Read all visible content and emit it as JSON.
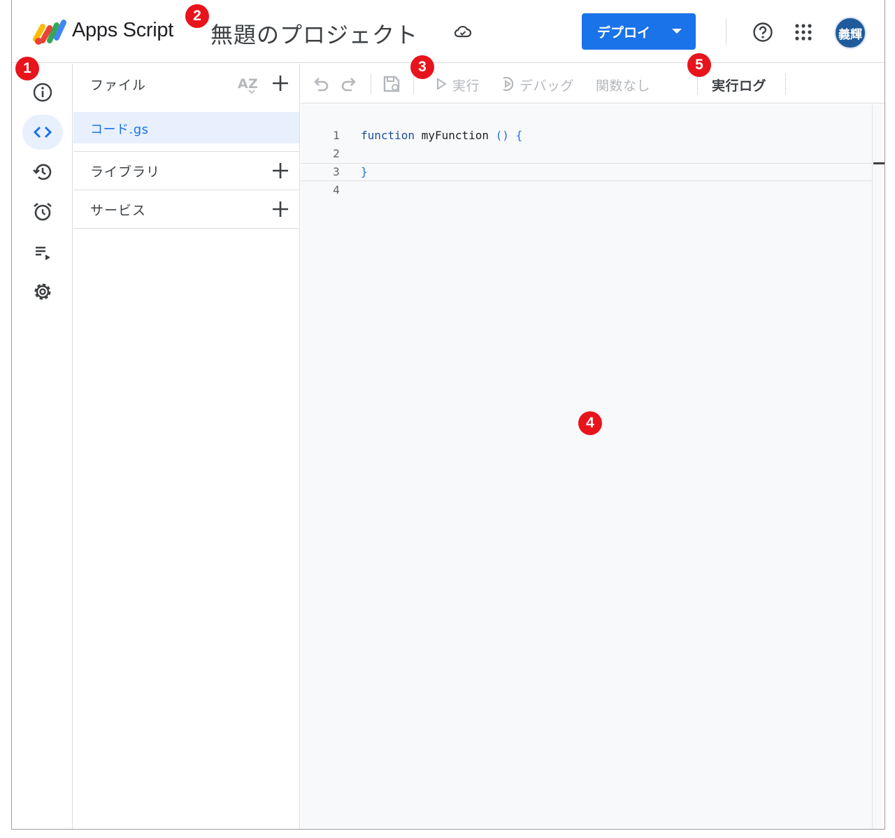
{
  "header": {
    "app_name": "Apps Script",
    "project_title": "無題のプロジェクト",
    "deploy_label": "デプロイ",
    "avatar_text": "義輝"
  },
  "files_panel": {
    "files_label": "ファイル",
    "files": [
      {
        "name": "コード.gs",
        "selected": true
      }
    ],
    "libraries_label": "ライブラリ",
    "services_label": "サービス"
  },
  "toolbar": {
    "run_label": "実行",
    "debug_label": "デバッグ",
    "function_select_label": "関数なし",
    "execution_log_label": "実行ログ"
  },
  "editor": {
    "lines": [
      {
        "number": "1",
        "keyword": "function",
        "name": " myFunction",
        "punct": "() {"
      },
      {
        "number": "2"
      },
      {
        "number": "3",
        "punct": "}"
      },
      {
        "number": "4"
      }
    ]
  },
  "annotations": [
    "1",
    "2",
    "3",
    "4",
    "5"
  ],
  "colors": {
    "accent": "#1a73e8",
    "badge": "#e8141c",
    "selected_file_bg": "#e8f0fe"
  }
}
